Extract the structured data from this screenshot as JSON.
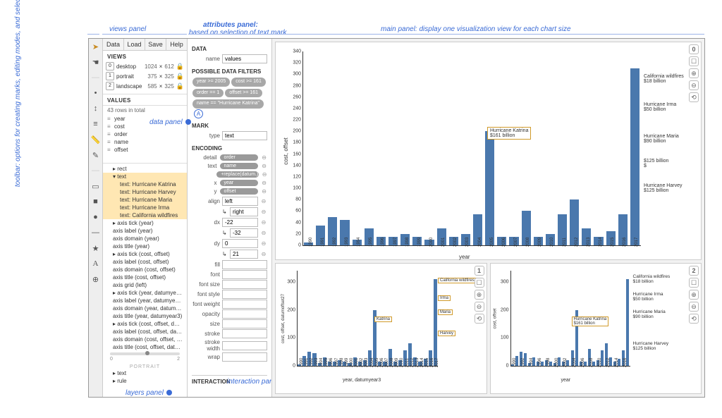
{
  "annotations": {
    "toolbar": "toolbar: options for creating marks, editing modes, and selection types",
    "views_panel": "views panel",
    "attributes_panel": "attributes panel:",
    "attributes_sub": "based on selection of text mark",
    "main_panel": "main panel: display one visualization view for each chart size",
    "data_panel": "data panel",
    "layers_panel": "layers panel",
    "interaction_panel": "interaction panel",
    "circle_a": "A"
  },
  "menubar": [
    "Data",
    "Load",
    "Save",
    "Help"
  ],
  "views": {
    "header": "VIEWS",
    "rows": [
      {
        "idx": "0",
        "name": "desktop",
        "w": "1024",
        "h": "612"
      },
      {
        "idx": "1",
        "name": "portrait",
        "w": "375",
        "h": "325"
      },
      {
        "idx": "2",
        "name": "landscape",
        "w": "585",
        "h": "325"
      }
    ],
    "times": "×",
    "lock": "🔒"
  },
  "values": {
    "header": "VALUES",
    "row_count": "43 rows in total",
    "items": [
      "year",
      "cost",
      "order",
      "name",
      "offset"
    ]
  },
  "layers": {
    "portrait_label": "PORTRAIT",
    "nodes": [
      {
        "t": "▸ rect",
        "sub": false,
        "sel": false
      },
      {
        "t": "▾ text",
        "sub": false,
        "sel": true
      },
      {
        "t": "text: Hurricane Katrina",
        "sub": true,
        "sel": true
      },
      {
        "t": "text: Hurricane Harvey",
        "sub": true,
        "sel": true
      },
      {
        "t": "text: Hurricane Maria",
        "sub": true,
        "sel": true
      },
      {
        "t": "text: Hurricane Irma",
        "sub": true,
        "sel": true
      },
      {
        "t": "text: California wildfires",
        "sub": true,
        "sel": true
      },
      {
        "t": "▸ axis tick (year)",
        "sub": false,
        "sel": false
      },
      {
        "t": "axis label (year)",
        "sub": false,
        "sel": false
      },
      {
        "t": "axis domain (year)",
        "sub": false,
        "sel": false
      },
      {
        "t": "axis title (year)",
        "sub": false,
        "sel": false
      },
      {
        "t": "▸ axis tick (cost, offset)",
        "sub": false,
        "sel": false
      },
      {
        "t": "axis label (cost, offset)",
        "sub": false,
        "sel": false
      },
      {
        "t": "axis domain (cost, offset)",
        "sub": false,
        "sel": false
      },
      {
        "t": "axis title (cost, offset)",
        "sub": false,
        "sel": false
      },
      {
        "t": "axis grid (left)",
        "sub": false,
        "sel": false
      },
      {
        "t": "▸ axis tick (year, datumyear3)",
        "sub": false,
        "sel": false
      },
      {
        "t": "axis label (year, datumyear3)",
        "sub": false,
        "sel": false
      },
      {
        "t": "axis domain (year, datumyear3)",
        "sub": false,
        "sel": false
      },
      {
        "t": "axis title (year, datumyear3)",
        "sub": false,
        "sel": false
      },
      {
        "t": "▸ axis tick (cost, offset, datumo…",
        "sub": false,
        "sel": false
      },
      {
        "t": "axis label (cost, offset, datumo…",
        "sub": false,
        "sel": false
      },
      {
        "t": "axis domain (cost, offset, dat…",
        "sub": false,
        "sel": false
      },
      {
        "t": "axis title (cost, offset, datumo…",
        "sub": false,
        "sel": false
      }
    ],
    "slider_labels": [
      "0",
      "2"
    ],
    "tail": [
      "▸ text",
      "▸ rule"
    ]
  },
  "attributes": {
    "data_hdr": "DATA",
    "data_name_lbl": "name",
    "data_name_val": "values",
    "filters_hdr": "POSSIBLE DATA FILTERS",
    "filters": [
      "year >= 2005",
      "cost >= 161",
      "order == 1",
      "offset >= 161",
      "name == \"Hurricane Katrina\""
    ],
    "mark_hdr": "MARK",
    "mark_type_lbl": "type",
    "mark_type_val": "text",
    "encoding_hdr": "ENCODING",
    "enc": [
      {
        "lbl": "detail",
        "pill": "order"
      },
      {
        "lbl": "text",
        "pill": "name"
      },
      {
        "lbl": "",
        "pill": "+replace(datum.)"
      },
      {
        "lbl": "x",
        "pill": "year"
      },
      {
        "lbl": "y",
        "pill": "offset"
      }
    ],
    "align_lbl": "align",
    "align_val": "left",
    "align_ref": "right",
    "dx_lbl": "dx",
    "dx_val": "-22",
    "dx_ref": "-32",
    "dy_lbl": "dy",
    "dy_val": "0",
    "dy_ref": "21",
    "rest": [
      "fill",
      "font",
      "font size",
      "font style",
      "font weight",
      "opacity",
      "size",
      "stroke",
      "stroke width",
      "wrap"
    ],
    "interaction_hdr": "INTERACTION"
  },
  "main": {
    "idx": [
      "0",
      "1",
      "2"
    ],
    "xlabel": "year",
    "xlabel1": "year, datumyear3",
    "ylabel0": "cost, offset",
    "ylabel1": "cost, offset, datumoffset27",
    "big_labels": [
      "California wildfires $18 billion",
      "Hurricane Irma $50 billion",
      "Hurricane Maria $90 billion",
      "$125 billion",
      "Hurricane Harvey $125 billion"
    ],
    "katrina": "Hurricane Katrina $161 billion",
    "sm_left_labels": [
      "California wildfires",
      "Irma",
      "Maria",
      "Harvey",
      "Katrina"
    ]
  },
  "chart_data": {
    "type": "bar",
    "title": "",
    "xlabel": "year",
    "ylabel": "cost, offset",
    "ylim": [
      0,
      340
    ],
    "yticks": [
      0,
      20,
      40,
      60,
      80,
      100,
      120,
      140,
      160,
      180,
      200,
      220,
      240,
      260,
      280,
      300,
      320,
      340
    ],
    "categories": [
      1990,
      1991,
      1992,
      1993,
      1994,
      1995,
      1996,
      1997,
      1998,
      1999,
      2000,
      2001,
      2002,
      2003,
      2004,
      2005,
      2006,
      2007,
      2008,
      2009,
      2010,
      2011,
      2012,
      2013,
      2014,
      2015,
      2016,
      2017
    ],
    "values": [
      5,
      35,
      50,
      45,
      10,
      30,
      15,
      15,
      20,
      15,
      10,
      30,
      15,
      20,
      55,
      200,
      15,
      15,
      60,
      15,
      20,
      55,
      80,
      30,
      15,
      25,
      55,
      310
    ],
    "annotations": [
      {
        "year": 2005,
        "text": "Hurricane Katrina $161 billion",
        "value": 161
      },
      {
        "year": 2017,
        "text": "California wildfires $18 billion",
        "value": 18
      },
      {
        "year": 2017,
        "text": "Hurricane Irma $50 billion",
        "value": 50
      },
      {
        "year": 2017,
        "text": "Hurricane Maria $90 billion",
        "value": 90
      },
      {
        "year": 2017,
        "text": "Hurricane Harvey $125 billion",
        "value": 125
      }
    ]
  }
}
